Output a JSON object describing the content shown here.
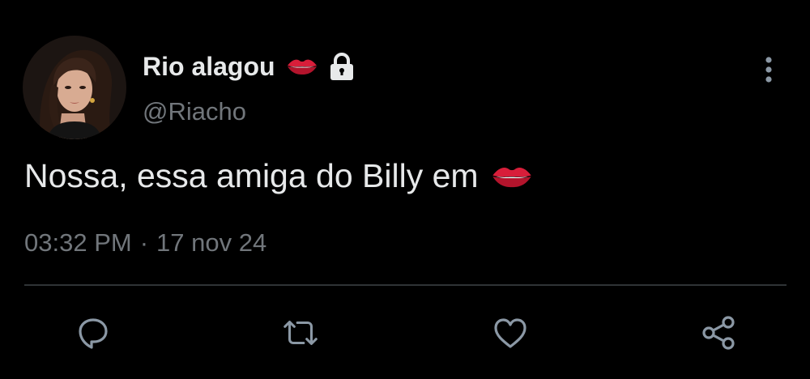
{
  "author": {
    "display_name": "Rio alagou",
    "handle": "@Riacho",
    "name_emoji": "lips-emoji",
    "protected_icon": "lock-icon",
    "avatar": "avatar-photo"
  },
  "tweet": {
    "text": "Nossa, essa amiga do Billy em",
    "trailing_emoji": "lips-emoji",
    "time": "03:32 PM",
    "separator": "·",
    "date": "17 nov 24"
  },
  "actions": [
    {
      "name": "reply",
      "icon": "reply-icon"
    },
    {
      "name": "retweet",
      "icon": "retweet-icon"
    },
    {
      "name": "like",
      "icon": "heart-icon"
    },
    {
      "name": "share",
      "icon": "share-icon"
    }
  ],
  "menu_icon": "more-vertical-icon",
  "colors": {
    "background": "#000000",
    "primary_text": "#e7e9ea",
    "secondary_text": "#71767b",
    "divider": "#2f3336",
    "action_icon": "#8b98a5",
    "lips": "#d81e3a"
  }
}
